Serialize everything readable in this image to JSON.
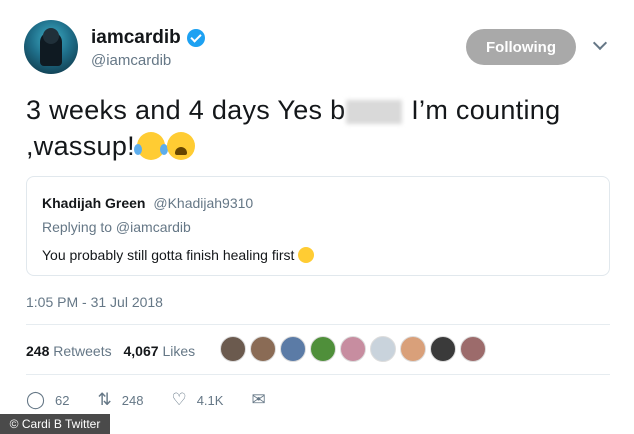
{
  "user": {
    "display_name": "iamcardib",
    "handle": "@iamcardib",
    "verified": true
  },
  "follow_button_label": "Following",
  "tweet": {
    "text_line1_start": "3 weeks and 4 days Yes b",
    "text_line1_end": " I’m counting",
    "text_line2": ",wassup!",
    "emojis": [
      "face-with-tears-of-joy-icon",
      "weary-face-icon"
    ]
  },
  "quoted_tweet": {
    "name": "Khadijah Green",
    "handle": "@Khadijah9310",
    "replying_to": "Replying to @iamcardib",
    "text": "You probably still gotta finish healing first"
  },
  "timestamp": "1:05 PM - 31 Jul 2018",
  "stats": {
    "retweets_count": "248",
    "retweets_label": "Retweets",
    "likes_count": "4,067",
    "likes_label": "Likes"
  },
  "actions": {
    "replies": "62",
    "retweets": "248",
    "likes": "4.1K"
  },
  "credit": "© Cardi B Twitter",
  "colors": {
    "verified": "#1da1f2",
    "follow_button": "#a9a9a9",
    "muted_text": "#657786"
  }
}
